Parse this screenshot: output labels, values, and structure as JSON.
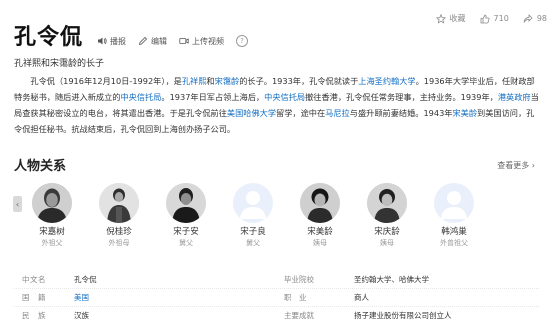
{
  "topbar": {
    "collect": "收藏",
    "likes": "710",
    "shares": "98"
  },
  "title": "孔令侃",
  "actions": {
    "play": "播报",
    "edit": "编辑",
    "upload": "上传视频"
  },
  "subtitle": "孔祥熙和宋霭龄的长子",
  "intro": {
    "s1": "孔令侃（1916年12月10日-1992年），是",
    "l1": "孔祥熙",
    "s2": "和",
    "l2": "宋霭龄",
    "s3": "的长子。1933年，孔令侃就读于",
    "l3": "上海圣约翰大学",
    "s4": "。1936年大学毕业后，任财政部特务秘书，随后进入新成立的",
    "l4": "中央信托局",
    "s5": "。1937年日军占领上海后，",
    "l5": "中央信托局",
    "s6": "撤往香港，孔令侃任常务理事，主持业务。1939年，",
    "l6": "港英政府",
    "s7": "当局查获其秘密设立的电台，将其遣出香港。于是孔令侃前往",
    "l7": "美国哈佛大学",
    "s8": "留学，途中在",
    "l8": "马尼拉",
    "s9": "与盛升颐前妻结婚。1943年",
    "l9": "宋美龄",
    "s10": "到美国访问，孔令侃担任秘书。抗战结束后，孔令侃回到上海创办扬子公司。"
  },
  "relations": {
    "title": "人物关系",
    "more": "查看更多",
    "people": [
      {
        "name": "宋嘉树",
        "relation": "外祖父",
        "avatar": "photo"
      },
      {
        "name": "倪桂珍",
        "relation": "外祖母",
        "avatar": "photo"
      },
      {
        "name": "宋子安",
        "relation": "舅父",
        "avatar": "photo"
      },
      {
        "name": "宋子良",
        "relation": "舅父",
        "avatar": "placeholder"
      },
      {
        "name": "宋美龄",
        "relation": "姨母",
        "avatar": "photo"
      },
      {
        "name": "宋庆龄",
        "relation": "姨母",
        "avatar": "photo"
      },
      {
        "name": "韩鸿巢",
        "relation": "外曾祖父",
        "avatar": "placeholder"
      }
    ]
  },
  "info": {
    "rows": [
      {
        "k1": "中文名",
        "v1": "孔令侃",
        "k2": "毕业院校",
        "v2": "圣约翰大学、哈佛大学"
      },
      {
        "k1": "国　籍",
        "v1": "美国",
        "k2": "职　业",
        "v2": "商人"
      },
      {
        "k1": "民　族",
        "v1": "汉族",
        "k2": "主要成就",
        "v2": "扬子建业股份有限公司创立人"
      }
    ]
  },
  "colors": {
    "link": "#136ec2",
    "avatar_placeholder": "#e9f0fb"
  }
}
